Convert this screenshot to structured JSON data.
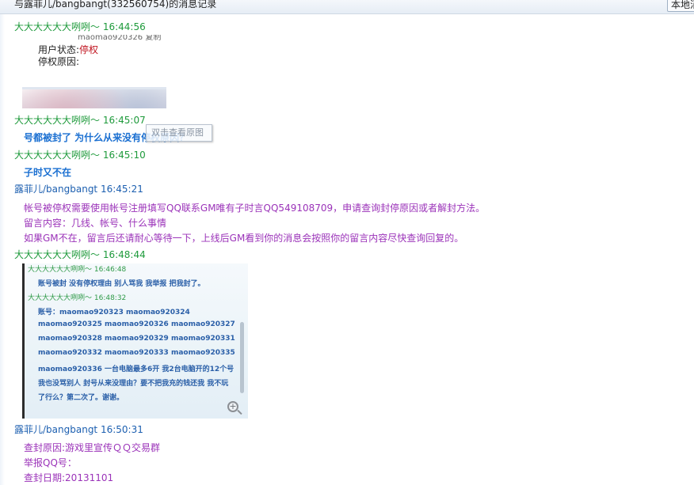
{
  "titlebar": {
    "title": "与露菲儿/bangbangt(332560754)的消息记录",
    "local_button": "本地消"
  },
  "messages": [
    {
      "sender": "大大大大大大咧咧～",
      "time": "16:44:56"
    },
    {
      "sender": "大大大大大大咧咧～",
      "time": "16:45:07",
      "text": "号都被封了 为什么从来没有停权原因？"
    },
    {
      "sender": "大大大大大大咧咧～",
      "time": "16:45:10",
      "text": "子时又不在"
    },
    {
      "sender": "露菲儿/bangbangt",
      "time": "16:45:21",
      "lines": [
        "帐号被停权需要使用帐号注册填写QQ联系GM唯有子时言QQ549108709，申请查询封停原因或者解封方法。",
        "留言内容：几线、帐号、什么事情",
        "如果GM不在，留言后还请耐心等待一下，上线后GM看到你的消息会按照你的留言内容尽快查询回复的。"
      ]
    },
    {
      "sender": "大大大大大大咧咧～",
      "time": "16:48:44"
    },
    {
      "sender": "露菲儿/bangbangt",
      "time": "16:50:31",
      "lines": [
        "查封原因:游戏里宣传ＱＱ交易群",
        "举报QQ号：",
        "查封日期:20131101"
      ]
    }
  ],
  "image1": {
    "cut_text": "maomao920326 复制",
    "status_label": "用户状态:",
    "status_value": "停权",
    "reason_label": "停权原因:"
  },
  "tooltip": "双击查看原图",
  "image2": {
    "lines": [
      "大大大大大大咧咧～  16:46:48",
      "账号被封 没有停权理由  别人骂我 我举报  把我封了。",
      "大大大大大大咧咧～  16:48:32",
      "账号：maomao920323 maomao920324",
      "maomao920325 maomao920326 maomao920327",
      "maomao920328 maomao920329  maomao920331",
      "maomao920332 maomao920333 maomao920335",
      "maomao920336  一台电脑最多6开 我2台电脑开的12个号",
      "我也没骂别人 封号从来没理由？要不把我充的钱还我 我不玩",
      "了行么？第二次了。谢谢。"
    ]
  },
  "colors": {
    "sender_self": "#1e9a3b",
    "sender_other": "#1c5fb0",
    "bold_text": "#1a6fd1",
    "purple_text": "#9b33b9",
    "status_red": "#c0141f"
  }
}
